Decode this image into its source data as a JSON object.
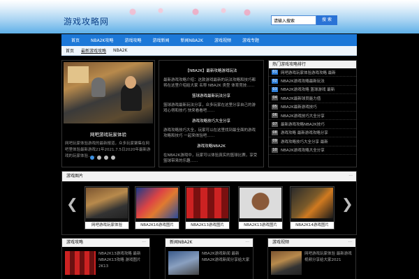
{
  "header": {
    "logo": "游戏攻略网",
    "search_value": "请输入搜索",
    "search_button": "搜 索"
  },
  "nav": [
    "首页",
    "NBA2K攻略",
    "游戏攻略",
    "游戏新闻",
    "新闻NBA2K",
    "游戏视频",
    "游戏专题"
  ],
  "breadcrumb": [
    "首页",
    "最新游戏攻略",
    "NBA2K",
    "",
    "",
    ""
  ],
  "feature": {
    "title": "网吧游戏玩家体验",
    "desc": "网吧玩家体验游戏的最新报道，众多玩家聚集在网吧里体验最新游戏21年2021.7.5日2020年最新游戏的玩家体验……",
    "dots": 4
  },
  "articles": [
    {
      "head": "【NBA2K】最新攻略游戏玩法",
      "body": "最新游戏攻略介绍：这款游戏最新的玩法攻略和技巧都将在这里介绍给大家 名称 NBA2K 类型 体育竞技……"
    },
    {
      "head": "篮球游戏最新玩法分享",
      "body": "篮球游戏最新玩法分享，众多玩家在这里分享自己的游戏心得和技巧 快来看看吧……"
    },
    {
      "head": "游戏攻略技巧大全分享",
      "body": "游戏攻略技巧大全，玩家可以在这里找到最全面的游戏攻略和技巧 一起来体验吧……"
    },
    {
      "head": "游戏攻略NBA2K",
      "body": "在NBA2K游戏中，玩家可以体验真实的篮球比赛，享受篮球带来的乐趣……"
    }
  ],
  "ranking": {
    "title": "热门游戏攻略排行",
    "items": [
      "网吧游戏玩家体验游戏攻略 最新",
      "NBA2K游戏攻略最新玩法",
      "NBA2K游戏攻略 篮球游戏 最新",
      "NBA2K最新球员能力值",
      "NBA2K最新游戏技巧",
      "NBA2K游戏技巧大全分享",
      "最新游戏攻略NBA2K技巧",
      "游戏攻略 最新游戏攻略分享",
      "游戏攻略技巧大全分享 最新",
      "NBA2K游戏攻略大全分享"
    ]
  },
  "strip": {
    "title": "游戏图片",
    "more": "···",
    "thumbs": [
      "网吧游戏玩家体验",
      "NBA2K16游戏图片",
      "NBA2K13游戏图片",
      "NBA2K13游戏图片",
      "NBA2K14游戏图片"
    ]
  },
  "columns": [
    {
      "title": "游戏攻略",
      "more": "···",
      "text": "NBA2K13游戏攻略 最新 NBA2K13攻略 游戏图片 2K13"
    },
    {
      "title": "新闻NBA2K",
      "more": "···",
      "text": "NBA2K游戏新闻 最新NBA2K游戏新闻分享给大家"
    },
    {
      "title": "游戏视频",
      "more": "···",
      "text": "网吧游戏玩家体验 最新游戏视频分享给大家2021"
    }
  ],
  "colors": {
    "nav": "#1c78d8",
    "accent": "#2f7fd8",
    "background": "#000000"
  }
}
